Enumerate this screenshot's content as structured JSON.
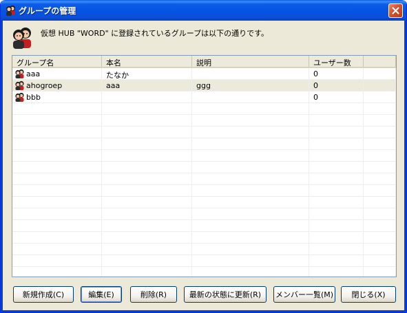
{
  "window": {
    "title": "グループの管理"
  },
  "header": {
    "text": "仮想 HUB \"WORD\" に登録されているグループは以下の通りです。"
  },
  "columns": [
    "グループ名",
    "本名",
    "説明",
    "ユーザー数"
  ],
  "rows": [
    {
      "name": "aaa",
      "realname": "たなか",
      "description": "",
      "users": "0"
    },
    {
      "name": "ahogroep",
      "realname": "aaa",
      "description": "ggg",
      "users": "0"
    },
    {
      "name": "bbb",
      "realname": "",
      "description": "",
      "users": "0"
    }
  ],
  "buttons": {
    "new": "新規作成(C)",
    "edit": "編集(E)",
    "delete": "削除(R)",
    "refresh": "最新の状態に更新(R)",
    "members": "メンバー一覧(M)",
    "close": "閉じる(X)"
  },
  "icons": {
    "title": "group-icon",
    "header": "group-icon",
    "row": "group-icon",
    "close": "close-icon"
  },
  "colors": {
    "titlebar": "#0553e0",
    "close_button": "#d6502c",
    "window_bg": "#ece9d8",
    "selection": "#ebeadb"
  }
}
